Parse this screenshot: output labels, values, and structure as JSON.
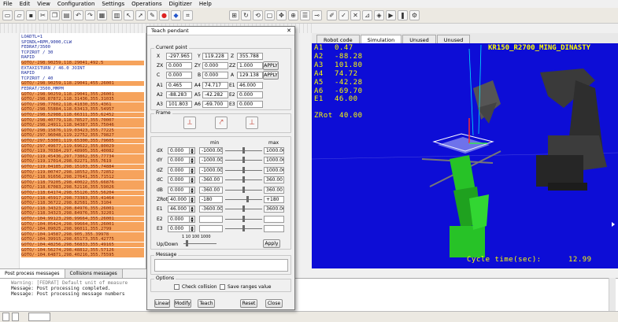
{
  "menubar": [
    "File",
    "Edit",
    "View",
    "Configuration",
    "Settings",
    "Operations",
    "Digitizer",
    "Help"
  ],
  "toolbar": {
    "icons": [
      "new-file-icon",
      "open-file-icon",
      "save-icon",
      "cut-icon",
      "copy-icon",
      "paste-icon",
      "undo-icon",
      "redo-icon",
      "document-icon",
      "grid-icon",
      "pointer-icon",
      "arrow-icon",
      "paint-icon",
      "stop-icon",
      "record-icon",
      "frame-icon",
      "align-icon",
      "rotate-icon",
      "refresh-icon",
      "select-icon",
      "move-icon",
      "zoom-icon",
      "pan-icon",
      "link-icon",
      "edit-icon",
      "check-icon",
      "close-icon",
      "measure-icon",
      "view-icon",
      "play-icon",
      "pause-icon",
      "settings-icon"
    ]
  },
  "code": [
    {
      "text": "LOADTL=1",
      "hl": false
    },
    {
      "text": "SPINDL=RPM,9000,CLW",
      "hl": false
    },
    {
      "text": "FEDRAT/3500",
      "hl": false
    },
    {
      "text": "TCPZROT / 30",
      "hl": false
    },
    {
      "text": "RAPID",
      "hl": false
    },
    {
      "text": "GOTO/-298.90259,118.29041,492.5",
      "hl": true
    },
    {
      "text": "EXTAXISTURN / 46.0 JOINT",
      "hl": false
    },
    {
      "text": "RAPID",
      "hl": false
    },
    {
      "text": "TCPZROT / 40",
      "hl": false
    },
    {
      "text": "GOTO/-298.90259,118.29041,455.26001",
      "hl": true
    },
    {
      "text": "FEDRAT/3500,MMPM",
      "hl": false
    },
    {
      "text": "GOTO/-298.90259,118.29041,355.26001",
      "hl": true
    },
    {
      "text": "GOTO/-298.87872,118.31436,355.31035",
      "hl": true
    },
    {
      "text": "GOTO/-298.77602,118.41830,355.4361",
      "hl": true
    },
    {
      "text": "GOTO/-298.55884,118.63413,355.54957",
      "hl": true
    },
    {
      "text": "GOTO/-298.52988,118.66311,355.62452",
      "hl": true
    },
    {
      "text": "GOTO/-298.40779,118.78527,355.70007",
      "hl": true
    },
    {
      "text": "GOTO/-298.24911,118.94387,355.75046",
      "hl": true
    },
    {
      "text": "GOTO/-298.15876,119.03423,355.77225",
      "hl": true
    },
    {
      "text": "GOTO/-297.96048,119.22752,355.79827",
      "hl": true
    },
    {
      "text": "GOTO/-297.53001,119.65300,355.79605",
      "hl": true
    },
    {
      "text": "GOTO/-297.49677,119.69622,355.80029",
      "hl": true
    },
    {
      "text": "GOTO/-119.70384,297.48905,355.40082",
      "hl": true
    },
    {
      "text": "GOTO/-119.45436,297.73862,355.77734",
      "hl": true
    },
    {
      "text": "GOTO/-119.17014,298.02271,355.7619",
      "hl": true
    },
    {
      "text": "GOTO/-119.04185,298.15103,355.74884",
      "hl": true
    },
    {
      "text": "GOTO/-119.00747,298.18552,355.72852",
      "hl": true
    },
    {
      "text": "GOTO/-118.91656,298.27641,355.71512",
      "hl": true
    },
    {
      "text": "GOTO/-118.79205,298.40022,355.66876",
      "hl": true
    },
    {
      "text": "GOTO/-118.67083,298.52116,355.59026",
      "hl": true
    },
    {
      "text": "GOTO/-118.64174,298.55126,355.56204",
      "hl": true
    },
    {
      "text": "GOTO/-118.45917,298.73383,355.41464",
      "hl": true
    },
    {
      "text": "GOTO/-118.36722,298.82581,355.3104",
      "hl": true
    },
    {
      "text": "GOTO/-118.34323,298.84976,355.26001",
      "hl": true
    },
    {
      "text": "GOTO/-118.34323,298.84976,355.32201",
      "hl": true
    },
    {
      "text": "GOTO/-104.99123,298.99664,355.26001",
      "hl": true
    },
    {
      "text": "GOTO/-104.05424,298.99664,355.26001",
      "hl": true
    },
    {
      "text": "GOTO/-104.09025,298.96011,355.2799",
      "hl": true
    },
    {
      "text": "GOTO/-104.14587,298.905,355.39978",
      "hl": true
    },
    {
      "text": "GOTO/-104.39915,298.65173,355.42775",
      "hl": true
    },
    {
      "text": "GOTO/-104.48256,298.56833,355.49165",
      "hl": true
    },
    {
      "text": "GOTO/-104.56274,298.48812,355.57126",
      "hl": true
    },
    {
      "text": "GOTO/-104.64871,298.40216,355.75595",
      "hl": true
    }
  ],
  "bottom_tabs": {
    "post": "Post process messages",
    "collisions": "Collisions messages"
  },
  "messages": [
    {
      "text": "Warning: [FEDRAT] Default unit of measure",
      "gray": true
    },
    {
      "text": "Message: Post processing completed.",
      "gray": false
    },
    {
      "text": "Message: Post processing message numbers",
      "gray": false
    }
  ],
  "viewer": {
    "tabs": [
      "Robot code",
      "Simulation",
      "Unused",
      "Unused"
    ],
    "robot_name": "KR150_R2700_MING_DINASTY",
    "axes": [
      {
        "label": "A1",
        "value": "0.47"
      },
      {
        "label": "A2",
        "value": "-88.28"
      },
      {
        "label": "A3",
        "value": "101.80"
      },
      {
        "label": "A4",
        "value": "74.72"
      },
      {
        "label": "A5",
        "value": "-42.28"
      },
      {
        "label": "A6",
        "value": "-69.70"
      }
    ],
    "e1": {
      "label": "E1",
      "value": "46.00"
    },
    "zrot": {
      "label": "ZRot",
      "value": "40.00"
    },
    "cycle_label": "Cycle time(sec):",
    "cycle_value": "12.99"
  },
  "dialog": {
    "title": "Teach pendant",
    "current_point": {
      "label": "Current point",
      "X": "-297.965",
      "Y": "119.228",
      "Z": "355.788",
      "ZX": "0.000",
      "ZY": "0.000",
      "ZZ": "1.000",
      "C": "0.000",
      "B": "0.000",
      "A": "129.138",
      "A1": "0.465",
      "A4": "74.717",
      "E1": "46.000",
      "A2": "-88.283",
      "A5": "-42.282",
      "E2": "0.000",
      "A3": "101.803",
      "A6": "-69.700",
      "E3": "0.000",
      "apply": "APPLY"
    },
    "frame_label": "Frame",
    "jog": {
      "min_header": "min",
      "max_header": "max",
      "rows": [
        {
          "label": "dX",
          "value": "0.000",
          "min": "-1000.00",
          "max": "1000.00",
          "pos": 0.5
        },
        {
          "label": "dY",
          "value": "0.000",
          "min": "-1000.00",
          "max": "1000.00",
          "pos": 0.5
        },
        {
          "label": "dZ",
          "value": "0.000",
          "min": "-1000.00",
          "max": "1000.00",
          "pos": 0.5
        },
        {
          "label": "dC",
          "value": "0.000",
          "min": "-360.00",
          "max": "360.00",
          "pos": 0.5
        },
        {
          "label": "dB",
          "value": "0.000",
          "min": "-360.00",
          "max": "360.00",
          "pos": 0.5
        },
        {
          "label": "ZRot",
          "value": "40.000",
          "min": "-180",
          "max": "+180",
          "pos": 0.61
        },
        {
          "label": "E1",
          "value": "46.000",
          "min": "-3600.00",
          "max": "3600.00",
          "pos": 0.5
        },
        {
          "label": "E2",
          "value": "0.000",
          "min": "",
          "max": "",
          "pos": 0.5
        },
        {
          "label": "E3",
          "value": "0.000",
          "min": "",
          "max": "",
          "pos": 0.5
        }
      ],
      "scale_ticks": "1  10  100 1000",
      "updown_label": "Up/Down",
      "apply": "Apply"
    },
    "message_label": "Message",
    "options_label": "Options",
    "check_collision": "Check collision",
    "save_ranges": "Save ranges value",
    "buttons": {
      "linear": "Linear",
      "modify": "Modify",
      "teach": "Teach",
      "reset": "Reset",
      "close": "Close"
    }
  }
}
